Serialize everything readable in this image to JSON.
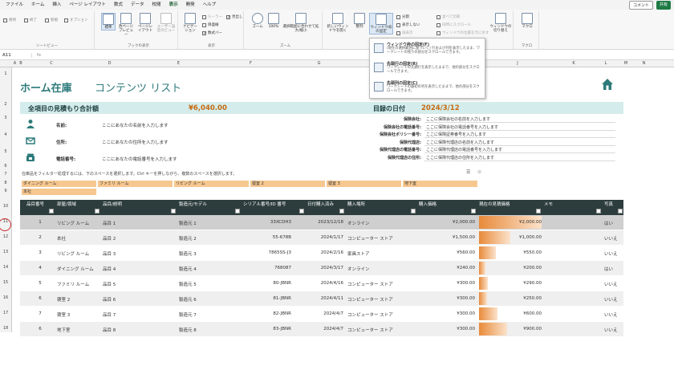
{
  "menu": [
    "ファイル",
    "ホーム",
    "挿入",
    "ページ レイアウト",
    "数式",
    "データ",
    "校閲",
    "表示",
    "開発",
    "ヘルプ"
  ],
  "menu_active": "表示",
  "comment_btn": "コメント",
  "share_btn": "共有",
  "ribbon": {
    "sheetview": {
      "items": [
        "保持",
        "終了",
        "新規",
        "オプション"
      ],
      "label": "シートビュー"
    },
    "bookview": {
      "items": [
        "標準",
        "改ページプレビュー",
        "ページレイアウト",
        "ユーザー設定のビュー"
      ],
      "label": "ブックの表示"
    },
    "show": {
      "items": [
        "ナビゲーション",
        "ルーラー",
        "目盛線",
        "見出し",
        "数式バー"
      ],
      "label": "表示"
    },
    "zoom": {
      "items": [
        "ズーム",
        "100%",
        "選択範囲に合わせて拡大/縮小"
      ],
      "label": "ズーム"
    },
    "window": {
      "items": [
        "新しいウィンドウを開く",
        "整列",
        "ウィンドウ枠の固定",
        "分割",
        "表示しない",
        "再表示",
        "並べて比較",
        "同時にスクロール",
        "ウィンドウの位置を元に戻す",
        "ウィンドウの切り替え"
      ],
      "label": ""
    },
    "macro": {
      "items": [
        "マクロ"
      ],
      "label": "マクロ"
    }
  },
  "formula": {
    "name": "A11",
    "fx": "fx"
  },
  "columns": [
    "A",
    "B",
    "C",
    "D",
    "E",
    "F",
    "G",
    "H",
    "I",
    "J",
    "K",
    "L",
    "M",
    "N"
  ],
  "rows": [
    "1",
    "2",
    "3",
    "4",
    "5",
    "6",
    "7",
    "8",
    "9",
    "10",
    "11",
    "12",
    "13",
    "14",
    "15",
    "16",
    "17",
    "18"
  ],
  "title_main": "ホーム在庫",
  "title_sub": "コンテンツ リスト",
  "band": {
    "total_label": "全項目の見積もり合計額",
    "total_value": "¥6,040.00",
    "date_label": "目録の日付",
    "date_value": "2024/3/12"
  },
  "owner": [
    {
      "label": "名前:",
      "value": "ここにあなたの名前を入力します"
    },
    {
      "label": "住所:",
      "value": "ここにあなたの住所を入力します"
    },
    {
      "label": "電話番号:",
      "value": "ここにあなたの電話番号を入力します"
    }
  ],
  "insurance": [
    {
      "label": "保険会社:",
      "value": "ここに保険会社の名前を入力します"
    },
    {
      "label": "保険会社の電話番号:",
      "value": "ここに保険会社の電話番号を入力します"
    },
    {
      "label": "保険会社ポリシー番号:",
      "value": "ここに保険証券番号を入力します"
    },
    {
      "label": "保険代理店:",
      "value": "ここに保険代理店の名前を入力します"
    },
    {
      "label": "保険代理店の電話番号:",
      "value": "ここに保険代理店の電話番号を入力します"
    },
    {
      "label": "保険代理店の住所:",
      "value": "ここに保険代理店の住所を入力します"
    }
  ],
  "slicer_hint": "在庫品をフィルター処理するには、下のスペースを選択します。Ctrl キーを押しながら、複数のスペースを選択します。",
  "slicers": [
    "ダイニング ルーム",
    "ファミリ ルーム",
    "リビング ルーム",
    "寝室 2",
    "寝室 3",
    "地下室",
    "本社"
  ],
  "table_headers": [
    "品目番号",
    "部屋/領域",
    "品目/説明",
    "製造元/モデル",
    "シリアル番号/ID 番号",
    "日付購入済み",
    "購入場所",
    "購入価格",
    "現在の見積価格",
    "メモ",
    "写真"
  ],
  "table_rows": [
    {
      "no": "1",
      "room": "リビング ルーム",
      "item": "品目 1",
      "maker": "製造元 1",
      "serial": "33XCDH3",
      "date": "2023/12/18",
      "place": "オンライン",
      "price": "¥2,000.00",
      "est": "¥2,000.00",
      "photo": "はい"
    },
    {
      "no": "2",
      "room": "本社",
      "item": "品目 2",
      "maker": "製造元 2",
      "serial": "55-678B",
      "date": "2024/1/17",
      "place": "コンピューター ストア",
      "price": "¥1,500.00",
      "est": "¥1,000.00",
      "photo": "いいえ"
    },
    {
      "no": "3",
      "room": "リビング ルーム",
      "item": "品目 3",
      "maker": "製造元 3",
      "serial": "7865SS-J3",
      "date": "2024/2/16",
      "place": "家具ストア",
      "price": "¥560.00",
      "est": "¥550.00",
      "photo": "いいえ"
    },
    {
      "no": "4",
      "room": "ダイニング ルーム",
      "item": "品目 4",
      "maker": "製造元 4",
      "serial": "768087",
      "date": "2024/3/17",
      "place": "オンライン",
      "price": "¥240.00",
      "est": "¥200.00",
      "photo": "はい"
    },
    {
      "no": "5",
      "room": "ファミリ ルーム",
      "item": "品目 5",
      "maker": "製造元 5",
      "serial": "80-JBNR",
      "date": "2024/4/16",
      "place": "コンピューター ストア",
      "price": "¥300.00",
      "est": "¥290.00",
      "photo": "いいえ"
    },
    {
      "no": "6",
      "room": "寝室 2",
      "item": "品目 6",
      "maker": "製造元 6",
      "serial": "81-JBNR",
      "date": "2024/4/11",
      "place": "コンピューター ストア",
      "price": "¥300.00",
      "est": "¥250.00",
      "photo": "いいえ"
    },
    {
      "no": "7",
      "room": "寝室 3",
      "item": "品目 7",
      "maker": "製造元 7",
      "serial": "82-JBNR",
      "date": "2024/4/7",
      "place": "コンピューター ストア",
      "price": "¥300.00",
      "est": "¥600.00",
      "photo": "いいえ"
    },
    {
      "no": "6",
      "room": "地下室",
      "item": "品目 8",
      "maker": "製造元 8",
      "serial": "83-JBNR",
      "date": "2024/4/7",
      "place": "コンピューター ストア",
      "price": "¥300.00",
      "est": "¥900.00",
      "photo": "いいえ"
    }
  ],
  "est_fraction": [
    1.0,
    0.5,
    0.275,
    0.1,
    0.145,
    0.125,
    0.3,
    0.45
  ],
  "freeze_menu": [
    {
      "title": "ウィンドウ枠の固定(F)",
      "desc": "(現在の選択範囲に基づいて) 行および列を表示したまま、ワークシートの残りの部分をスクロールできます。"
    },
    {
      "title": "先頭行の固定(R)",
      "desc": "ワークシートの先頭行を表示したままで、他の部分をスクロールできます。"
    },
    {
      "title": "先頭列の固定(C)",
      "desc": "ワークシートの最初の列を表示したままで、他の部分をスクロールできます。"
    }
  ],
  "colors": {
    "accent": "#1a7343",
    "teal": "#2e7a7a",
    "header": "#2d3d3e",
    "orange": "#e88a3a",
    "band": "#d4eceb"
  }
}
